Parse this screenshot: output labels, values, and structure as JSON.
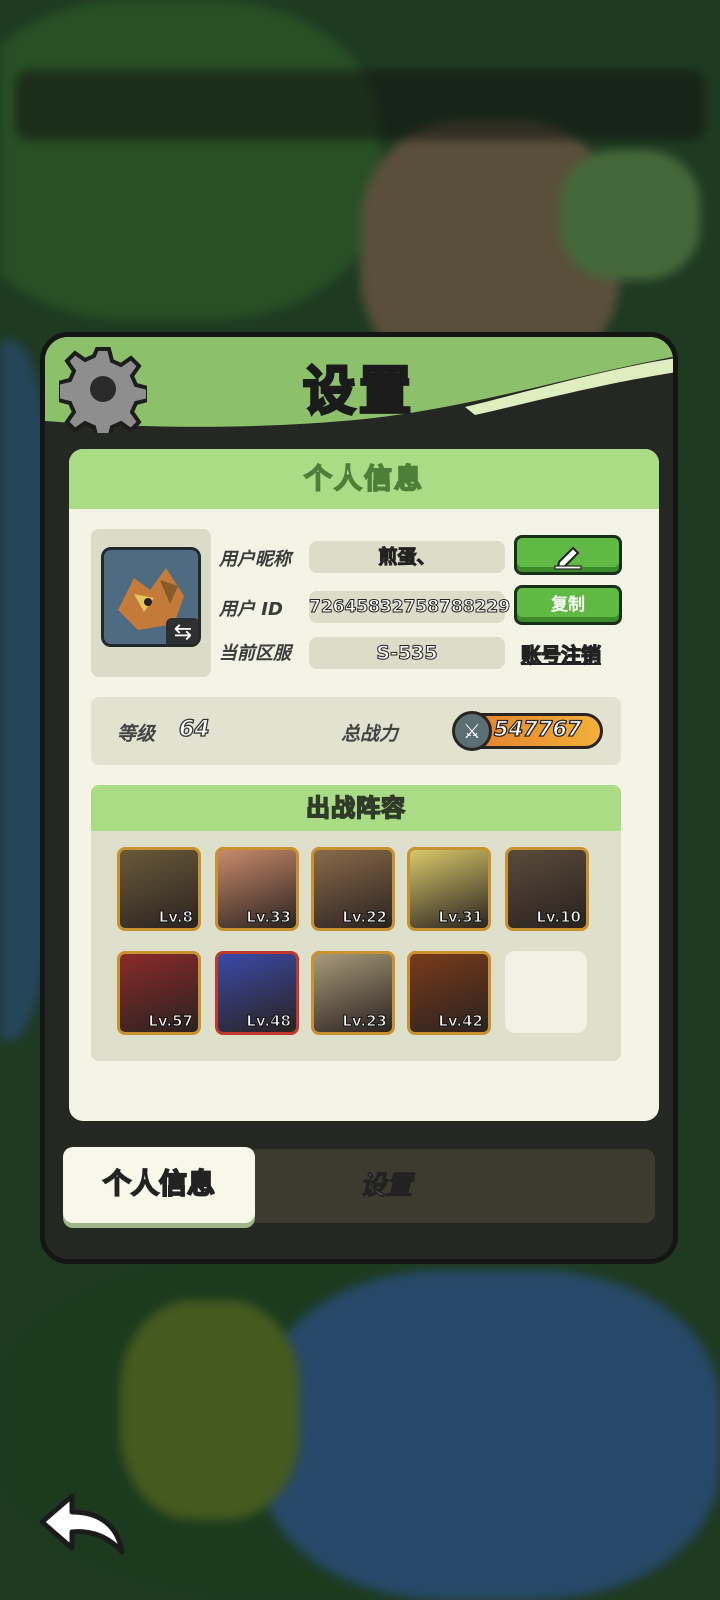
{
  "panel": {
    "title": "设置"
  },
  "profile": {
    "section_title": "个人信息",
    "nickname_label": "用户昵称",
    "nickname_value": "煎蛋、",
    "id_label": "用户  ID",
    "id_value": "72645832758788229",
    "server_label": "当前区服",
    "server_value": "S-535",
    "copy_label": "复制",
    "delete_account_label": "账号注销"
  },
  "stats": {
    "level_label": "等级",
    "level_value": "64",
    "power_label": "总战力",
    "power_value": "547767"
  },
  "team": {
    "title": "出战阵容",
    "heroes": [
      {
        "lv": "Lv.8",
        "color": "#6a5a3a"
      },
      {
        "lv": "Lv.33",
        "color": "#c98a6a"
      },
      {
        "lv": "Lv.22",
        "color": "#8a6a4a"
      },
      {
        "lv": "Lv.31",
        "color": "#d8c86a"
      },
      {
        "lv": "Lv.10",
        "color": "#5a4a3a"
      },
      {
        "lv": "Lv.57",
        "color": "#8a2a2a"
      },
      {
        "lv": "Lv.48",
        "color": "#3a4aa8"
      },
      {
        "lv": "Lv.23",
        "color": "#a89a7a"
      },
      {
        "lv": "Lv.42",
        "color": "#7a3a1a"
      }
    ]
  },
  "tabs": {
    "profile": "个人信息",
    "settings": "设置"
  },
  "colors": {
    "accent_green": "#8cc06a",
    "button_green": "#5fb943"
  }
}
